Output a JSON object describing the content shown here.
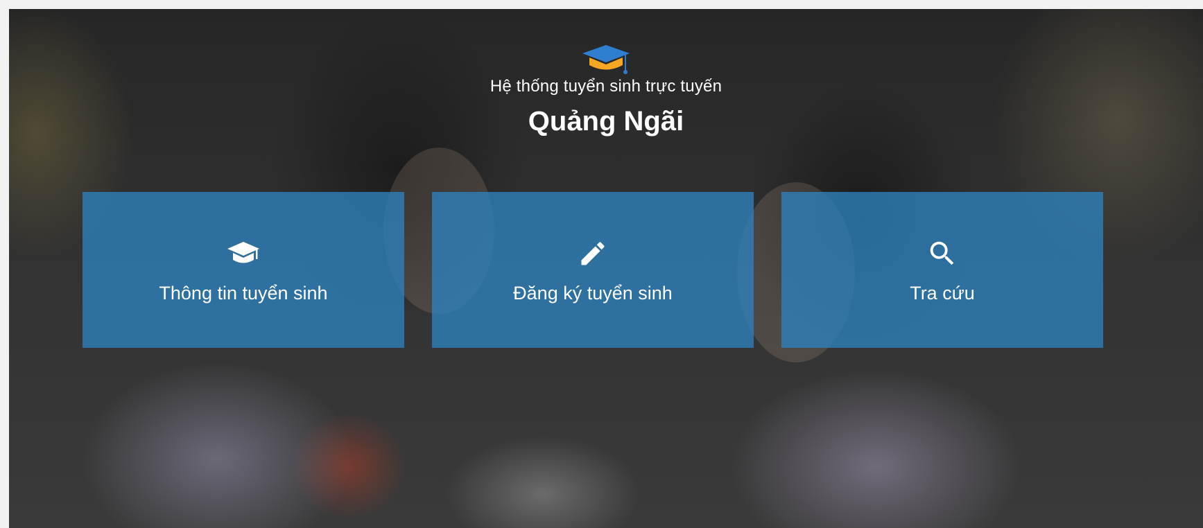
{
  "header": {
    "logo_icon": "graduation-cap-icon",
    "subtitle": "Hệ thống tuyển sinh trực tuyến",
    "title": "Quảng Ngãi"
  },
  "tiles": [
    {
      "label": "Thông tin tuyển sinh",
      "icon": "graduation-cap-icon"
    },
    {
      "label": "Đăng ký tuyển sinh",
      "icon": "pencil-icon"
    },
    {
      "label": "Tra cứu",
      "icon": "search-icon"
    }
  ],
  "colors": {
    "tile_background": "#2d82be",
    "logo_cap": "#2f7fd0",
    "logo_tassel": "#f5a623",
    "text": "#ffffff"
  }
}
